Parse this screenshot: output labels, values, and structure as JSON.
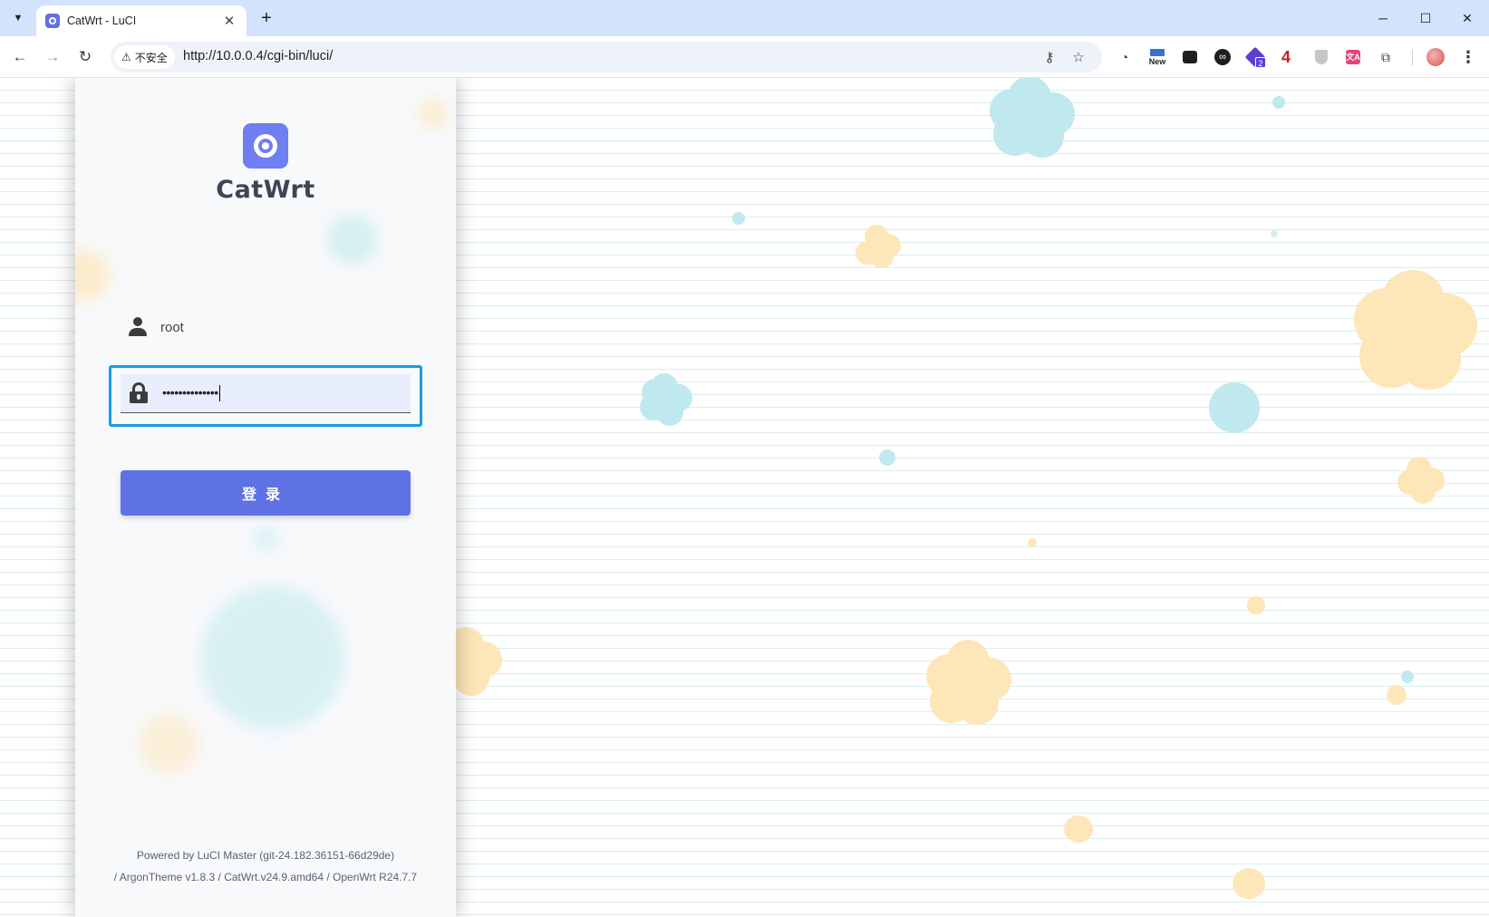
{
  "browser": {
    "tab_title": "CatWrt - LuCI",
    "tab_close": "✕",
    "new_tab": "+",
    "security_label": "不安全",
    "url": "http://10.0.0.4/cgi-bin/luci/",
    "ext_new_label": "New",
    "ext_badge_count": "4",
    "ext_badge_two": "2"
  },
  "login": {
    "brand": "CatWrt",
    "username": "root",
    "password_mask": "••••••••••••••",
    "submit_label": "登录"
  },
  "footer": {
    "line1": "Powered by LuCI Master (git-24.182.36151-66d29de)",
    "line2": "/ ArgonTheme v1.8.3 / CatWrt.v24.9.amd64 / OpenWrt R24.7.7"
  },
  "colors": {
    "accent": "#5e72e4",
    "focus_ring": "#1a9be6",
    "tabstrip": "#d3e3fd",
    "flower_blue": "#bfe9ee",
    "flower_yellow": "#fde6b8"
  }
}
